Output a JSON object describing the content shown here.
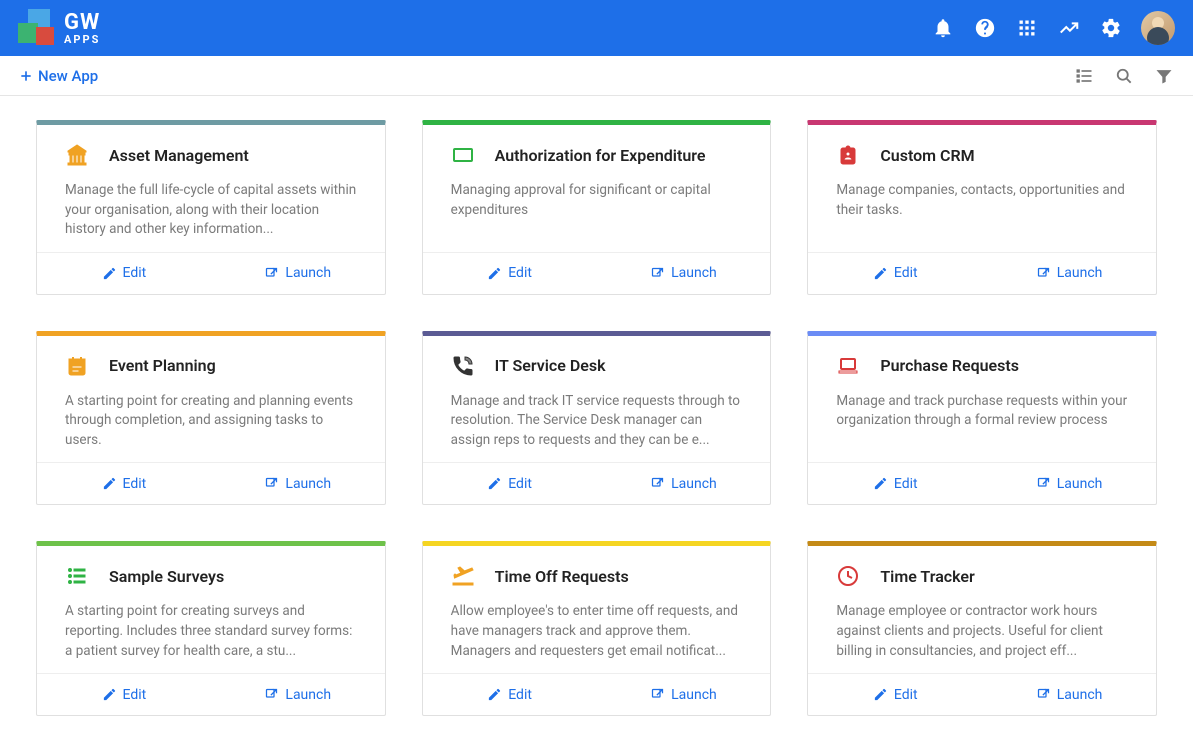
{
  "brand": {
    "gw": "GW",
    "apps": "APPS"
  },
  "subbar": {
    "new_app": "New App"
  },
  "actions": {
    "edit": "Edit",
    "launch": "Launch"
  },
  "accent_colors": {
    "teal": "#6e9ba3",
    "green": "#2fb344",
    "magenta": "#c83771",
    "orange": "#f0a223",
    "indigo": "#5b5b94",
    "periwinkle": "#6b8cf5",
    "lime": "#6ec24a",
    "yellow": "#f5d522",
    "ochre": "#c48a16"
  },
  "cards": [
    {
      "title": "Asset Management",
      "desc": "Manage the full life-cycle of capital assets within your organisation, along with their location history and other key information...",
      "accent": "teal",
      "icon": "bank-icon",
      "icon_color": "#f0a223"
    },
    {
      "title": "Authorization for Expenditure",
      "desc": "Managing approval for significant or capital expenditures",
      "accent": "green",
      "icon": "money-icon",
      "icon_color": "#2fb344"
    },
    {
      "title": "Custom CRM",
      "desc": "Manage companies, contacts, opportunities and their tasks.",
      "accent": "magenta",
      "icon": "badge-icon",
      "icon_color": "#d83a3a"
    },
    {
      "title": "Event Planning",
      "desc": "A starting point for creating and planning events through completion, and assigning tasks to users.",
      "accent": "orange",
      "icon": "calendar-icon",
      "icon_color": "#f0a223"
    },
    {
      "title": "IT Service Desk",
      "desc": "Manage and track IT service requests through to resolution. The Service Desk manager can assign reps to requests and they can be e...",
      "accent": "indigo",
      "icon": "phone-icon",
      "icon_color": "#333"
    },
    {
      "title": "Purchase Requests",
      "desc": "Manage and track purchase requests within your organization through a formal review process",
      "accent": "periwinkle",
      "icon": "laptop-icon",
      "icon_color": "#d83a3a"
    },
    {
      "title": "Sample Surveys",
      "desc": "A starting point for creating surveys and reporting. Includes three standard survey forms: a patient survey for health care, a stu...",
      "accent": "lime",
      "icon": "list-icon",
      "icon_color": "#2fb344"
    },
    {
      "title": "Time Off Requests",
      "desc": "Allow employee's to enter time off requests, and have managers track and approve them. Managers and requesters get email notificat...",
      "accent": "yellow",
      "icon": "plane-icon",
      "icon_color": "#f0a223"
    },
    {
      "title": "Time Tracker",
      "desc": "Manage employee or contractor work hours against clients and projects. Useful for client billing in consultancies, and project eff...",
      "accent": "ochre",
      "icon": "clock-icon",
      "icon_color": "#d83a3a"
    }
  ]
}
